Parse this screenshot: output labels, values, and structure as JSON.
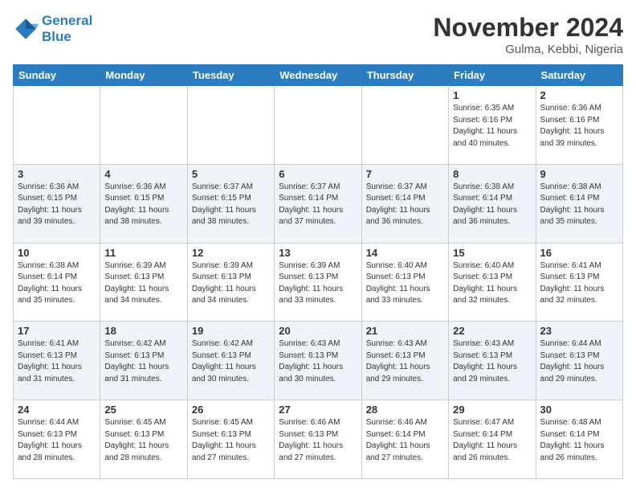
{
  "header": {
    "logo_line1": "General",
    "logo_line2": "Blue",
    "month_title": "November 2024",
    "location": "Gulma, Kebbi, Nigeria"
  },
  "weekdays": [
    "Sunday",
    "Monday",
    "Tuesday",
    "Wednesday",
    "Thursday",
    "Friday",
    "Saturday"
  ],
  "weeks": [
    [
      {
        "day": "",
        "sunrise": "",
        "sunset": "",
        "daylight": ""
      },
      {
        "day": "",
        "sunrise": "",
        "sunset": "",
        "daylight": ""
      },
      {
        "day": "",
        "sunrise": "",
        "sunset": "",
        "daylight": ""
      },
      {
        "day": "",
        "sunrise": "",
        "sunset": "",
        "daylight": ""
      },
      {
        "day": "",
        "sunrise": "",
        "sunset": "",
        "daylight": ""
      },
      {
        "day": "1",
        "sunrise": "Sunrise: 6:35 AM",
        "sunset": "Sunset: 6:16 PM",
        "daylight": "Daylight: 11 hours and 40 minutes."
      },
      {
        "day": "2",
        "sunrise": "Sunrise: 6:36 AM",
        "sunset": "Sunset: 6:16 PM",
        "daylight": "Daylight: 11 hours and 39 minutes."
      }
    ],
    [
      {
        "day": "3",
        "sunrise": "Sunrise: 6:36 AM",
        "sunset": "Sunset: 6:15 PM",
        "daylight": "Daylight: 11 hours and 39 minutes."
      },
      {
        "day": "4",
        "sunrise": "Sunrise: 6:36 AM",
        "sunset": "Sunset: 6:15 PM",
        "daylight": "Daylight: 11 hours and 38 minutes."
      },
      {
        "day": "5",
        "sunrise": "Sunrise: 6:37 AM",
        "sunset": "Sunset: 6:15 PM",
        "daylight": "Daylight: 11 hours and 38 minutes."
      },
      {
        "day": "6",
        "sunrise": "Sunrise: 6:37 AM",
        "sunset": "Sunset: 6:14 PM",
        "daylight": "Daylight: 11 hours and 37 minutes."
      },
      {
        "day": "7",
        "sunrise": "Sunrise: 6:37 AM",
        "sunset": "Sunset: 6:14 PM",
        "daylight": "Daylight: 11 hours and 36 minutes."
      },
      {
        "day": "8",
        "sunrise": "Sunrise: 6:38 AM",
        "sunset": "Sunset: 6:14 PM",
        "daylight": "Daylight: 11 hours and 36 minutes."
      },
      {
        "day": "9",
        "sunrise": "Sunrise: 6:38 AM",
        "sunset": "Sunset: 6:14 PM",
        "daylight": "Daylight: 11 hours and 35 minutes."
      }
    ],
    [
      {
        "day": "10",
        "sunrise": "Sunrise: 6:38 AM",
        "sunset": "Sunset: 6:14 PM",
        "daylight": "Daylight: 11 hours and 35 minutes."
      },
      {
        "day": "11",
        "sunrise": "Sunrise: 6:39 AM",
        "sunset": "Sunset: 6:13 PM",
        "daylight": "Daylight: 11 hours and 34 minutes."
      },
      {
        "day": "12",
        "sunrise": "Sunrise: 6:39 AM",
        "sunset": "Sunset: 6:13 PM",
        "daylight": "Daylight: 11 hours and 34 minutes."
      },
      {
        "day": "13",
        "sunrise": "Sunrise: 6:39 AM",
        "sunset": "Sunset: 6:13 PM",
        "daylight": "Daylight: 11 hours and 33 minutes."
      },
      {
        "day": "14",
        "sunrise": "Sunrise: 6:40 AM",
        "sunset": "Sunset: 6:13 PM",
        "daylight": "Daylight: 11 hours and 33 minutes."
      },
      {
        "day": "15",
        "sunrise": "Sunrise: 6:40 AM",
        "sunset": "Sunset: 6:13 PM",
        "daylight": "Daylight: 11 hours and 32 minutes."
      },
      {
        "day": "16",
        "sunrise": "Sunrise: 6:41 AM",
        "sunset": "Sunset: 6:13 PM",
        "daylight": "Daylight: 11 hours and 32 minutes."
      }
    ],
    [
      {
        "day": "17",
        "sunrise": "Sunrise: 6:41 AM",
        "sunset": "Sunset: 6:13 PM",
        "daylight": "Daylight: 11 hours and 31 minutes."
      },
      {
        "day": "18",
        "sunrise": "Sunrise: 6:42 AM",
        "sunset": "Sunset: 6:13 PM",
        "daylight": "Daylight: 11 hours and 31 minutes."
      },
      {
        "day": "19",
        "sunrise": "Sunrise: 6:42 AM",
        "sunset": "Sunset: 6:13 PM",
        "daylight": "Daylight: 11 hours and 30 minutes."
      },
      {
        "day": "20",
        "sunrise": "Sunrise: 6:43 AM",
        "sunset": "Sunset: 6:13 PM",
        "daylight": "Daylight: 11 hours and 30 minutes."
      },
      {
        "day": "21",
        "sunrise": "Sunrise: 6:43 AM",
        "sunset": "Sunset: 6:13 PM",
        "daylight": "Daylight: 11 hours and 29 minutes."
      },
      {
        "day": "22",
        "sunrise": "Sunrise: 6:43 AM",
        "sunset": "Sunset: 6:13 PM",
        "daylight": "Daylight: 11 hours and 29 minutes."
      },
      {
        "day": "23",
        "sunrise": "Sunrise: 6:44 AM",
        "sunset": "Sunset: 6:13 PM",
        "daylight": "Daylight: 11 hours and 29 minutes."
      }
    ],
    [
      {
        "day": "24",
        "sunrise": "Sunrise: 6:44 AM",
        "sunset": "Sunset: 6:13 PM",
        "daylight": "Daylight: 11 hours and 28 minutes."
      },
      {
        "day": "25",
        "sunrise": "Sunrise: 6:45 AM",
        "sunset": "Sunset: 6:13 PM",
        "daylight": "Daylight: 11 hours and 28 minutes."
      },
      {
        "day": "26",
        "sunrise": "Sunrise: 6:45 AM",
        "sunset": "Sunset: 6:13 PM",
        "daylight": "Daylight: 11 hours and 27 minutes."
      },
      {
        "day": "27",
        "sunrise": "Sunrise: 6:46 AM",
        "sunset": "Sunset: 6:13 PM",
        "daylight": "Daylight: 11 hours and 27 minutes."
      },
      {
        "day": "28",
        "sunrise": "Sunrise: 6:46 AM",
        "sunset": "Sunset: 6:14 PM",
        "daylight": "Daylight: 11 hours and 27 minutes."
      },
      {
        "day": "29",
        "sunrise": "Sunrise: 6:47 AM",
        "sunset": "Sunset: 6:14 PM",
        "daylight": "Daylight: 11 hours and 26 minutes."
      },
      {
        "day": "30",
        "sunrise": "Sunrise: 6:48 AM",
        "sunset": "Sunset: 6:14 PM",
        "daylight": "Daylight: 11 hours and 26 minutes."
      }
    ]
  ]
}
